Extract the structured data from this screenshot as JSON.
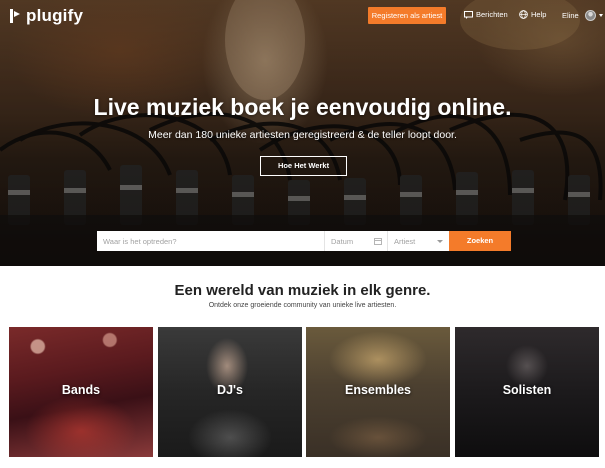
{
  "brand": {
    "name": "plugify"
  },
  "nav": {
    "register_label": "Registeren als artiest",
    "messages_label": "Berichten",
    "help_label": "Help",
    "user_name": "Eline"
  },
  "hero": {
    "title": "Live muziek boek je eenvoudig online.",
    "subtitle": "Meer dan 180 unieke artiesten geregistreerd & de teller loopt door.",
    "how_button": "Hoe Het Werkt"
  },
  "search": {
    "placeholder": "Waar is het optreden?",
    "date_placeholder": "Datum",
    "artist_placeholder": "Artiest",
    "button": "Zoeken"
  },
  "section": {
    "title": "Een wereld van muziek in elk genre.",
    "subtitle": "Ontdek onze groeiende community van unieke live artiesten."
  },
  "genres": [
    {
      "label": "Bands"
    },
    {
      "label": "DJ's"
    },
    {
      "label": "Ensembles"
    },
    {
      "label": "Solisten"
    }
  ],
  "colors": {
    "accent": "#f47b2a"
  }
}
